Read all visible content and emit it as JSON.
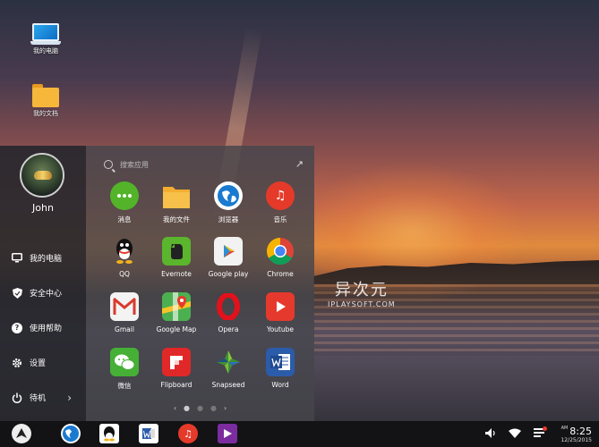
{
  "desktop": {
    "icons": [
      {
        "label": "我的电脑",
        "icon": "laptop-icon"
      },
      {
        "label": "我的文档",
        "icon": "folder-icon"
      }
    ],
    "watermark": {
      "cn": "异次元",
      "en": "IPLAYSOFT.COM"
    }
  },
  "start": {
    "user": {
      "name": "John"
    },
    "menu": [
      {
        "label": "我的电脑",
        "icon": "monitor-icon"
      },
      {
        "label": "安全中心",
        "icon": "shield-icon"
      },
      {
        "label": "使用帮助",
        "icon": "help-icon"
      },
      {
        "label": "设置",
        "icon": "gear-icon"
      },
      {
        "label": "待机",
        "icon": "power-icon",
        "chevron": "›"
      }
    ],
    "search": {
      "placeholder": "搜索应用",
      "expand_icon": "↗"
    },
    "apps": [
      {
        "name": "消息",
        "icon": "messages-icon",
        "color": "#53b42a"
      },
      {
        "name": "我的文件",
        "icon": "files-icon",
        "color": "#f4ae2f"
      },
      {
        "name": "浏览器",
        "icon": "browser-icon",
        "color": "#1a7ad0"
      },
      {
        "name": "音乐",
        "icon": "music-icon",
        "color": "#e53a2a"
      },
      {
        "name": "QQ",
        "icon": "qq-icon",
        "color": "#222222"
      },
      {
        "name": "Evernote",
        "icon": "evernote-icon",
        "color": "#5bb52d"
      },
      {
        "name": "Google play",
        "icon": "google-play-icon",
        "color": "#f2f2f2"
      },
      {
        "name": "Chrome",
        "icon": "chrome-icon",
        "color": "#e8ad23"
      },
      {
        "name": "Gmail",
        "icon": "gmail-icon",
        "color": "#f3f3f3"
      },
      {
        "name": "Google Map",
        "icon": "google-map-icon",
        "color": "#4caf50"
      },
      {
        "name": "Opera",
        "icon": "opera-icon",
        "color": "#e3111b"
      },
      {
        "name": "Youtube",
        "icon": "youtube-icon",
        "color": "#e5392d"
      },
      {
        "name": "微信",
        "icon": "wechat-icon",
        "color": "#45b035"
      },
      {
        "name": "Flipboard",
        "icon": "flipboard-icon",
        "color": "#e12828"
      },
      {
        "name": "Snapseed",
        "icon": "snapseed-icon",
        "color": "#3f8f35"
      },
      {
        "name": "Word",
        "icon": "word-icon",
        "color": "#2b5caa"
      }
    ],
    "pager": {
      "prev": "‹",
      "next": "›",
      "pages": 3,
      "current": 1
    }
  },
  "taskbar": {
    "apps": [
      "start-icon",
      "browser-icon",
      "qq-icon",
      "word-icon",
      "music-icon",
      "video-icon"
    ],
    "clock": {
      "ampm": "AM",
      "time": "8:25",
      "date": "12/25/2015"
    }
  }
}
